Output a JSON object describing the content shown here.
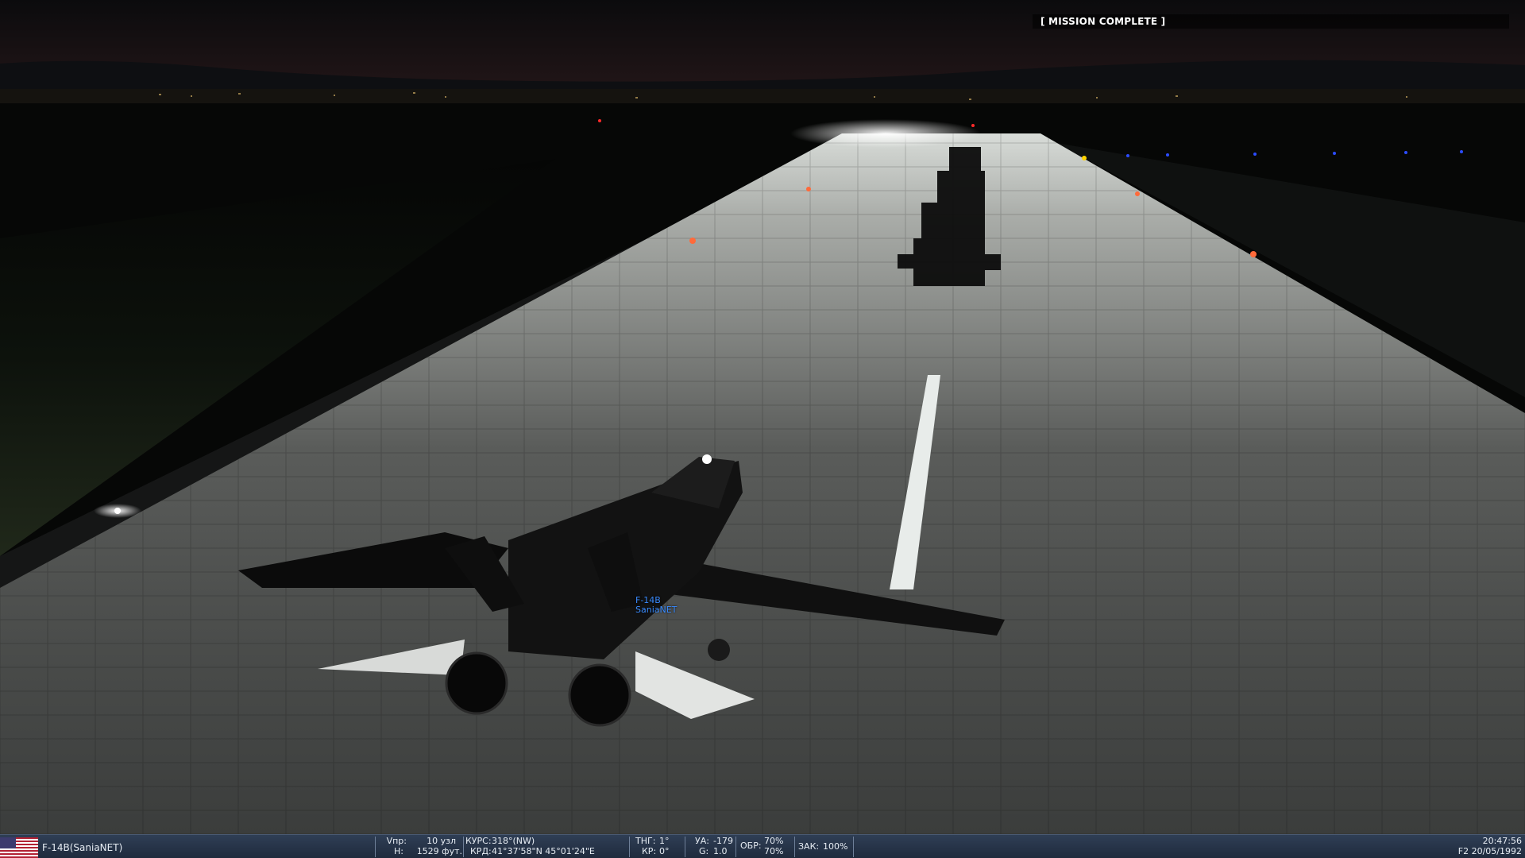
{
  "banner": {
    "text": "[ MISSION COMPLETE ]"
  },
  "aircraft_tag": {
    "line1": "F-14B",
    "line2": "SaniaNET"
  },
  "status": {
    "unit": "F-14B(SaniaNET)",
    "flag_icon": "usa-flag-icon",
    "vpr_label": "Vпр:",
    "vpr_value": "10 узл",
    "h_label": "H:",
    "h_value": "1529 фут.",
    "kurs_label": "КУРС:",
    "kurs_value": "318°(NW)",
    "krd_label": "КРД:",
    "krd_value": "41°37'58\"N 45°01'24\"E",
    "tng_label": "ТНГ:",
    "tng_value": "1°",
    "kr_label": "КР:",
    "kr_value": "0°",
    "ua_label": "УА:",
    "ua_value": "-179",
    "g_label": "G:",
    "g_value": "1.0",
    "obr_label": "ОБР:",
    "obr_value1": "70%",
    "obr_value2": "70%",
    "zak_label": "ЗАК:",
    "zak_value": "100%",
    "time": "20:47:56",
    "date": "F2 20/05/1992"
  },
  "colors": {
    "statusbar": "#2f3e55",
    "tag": "#3a8cff"
  }
}
